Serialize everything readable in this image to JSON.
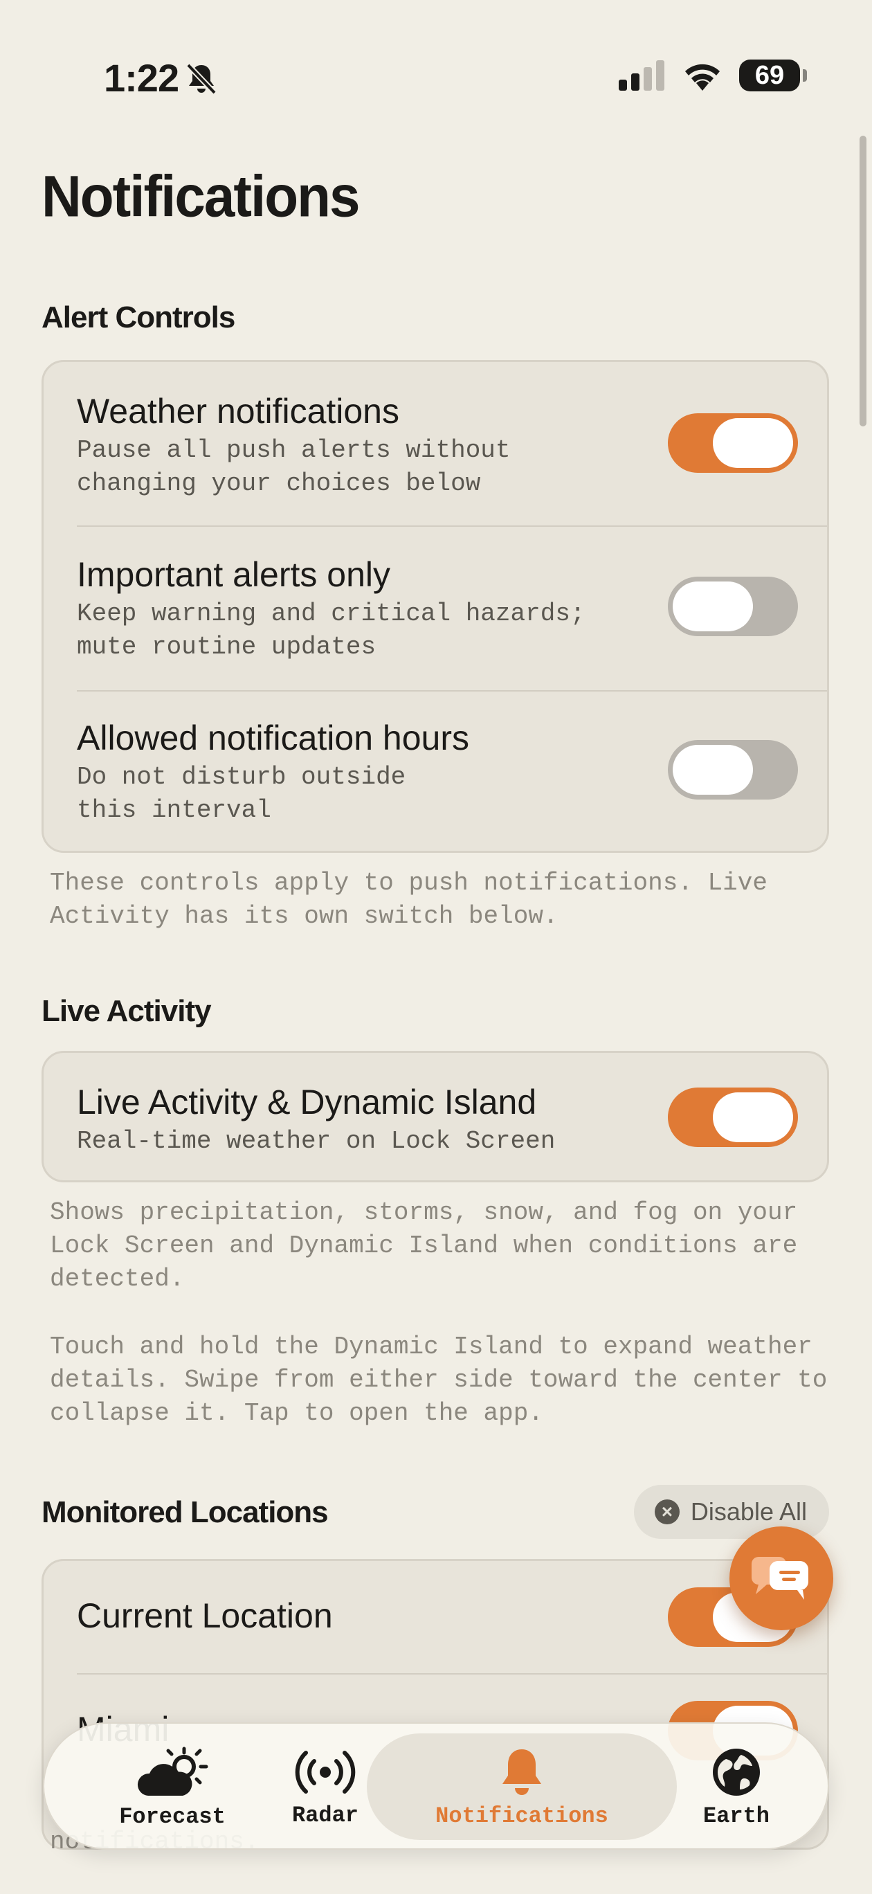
{
  "status": {
    "time": "1:22",
    "battery": "69"
  },
  "title": "Notifications",
  "sections": {
    "alert_controls": {
      "title": "Alert Controls",
      "rows": [
        {
          "title": "Weather notifications",
          "subtitle": "Pause all push alerts without\nchanging your choices below",
          "on": true
        },
        {
          "title": "Important alerts only",
          "subtitle": "Keep warning and critical hazards;\nmute routine updates",
          "on": false
        },
        {
          "title": "Allowed notification hours",
          "subtitle": "Do not disturb outside\nthis interval",
          "on": false
        }
      ],
      "footnote": "These controls apply to push notifications. Live Activity has its own switch below."
    },
    "live_activity": {
      "title": "Live Activity",
      "row": {
        "title": "Live Activity & Dynamic Island",
        "subtitle": "Real-time weather on Lock Screen",
        "on": true
      },
      "footnote1": "Shows precipitation, storms, snow, and fog on your Lock Screen and Dynamic Island when conditions are detected.",
      "footnote2": "Touch and hold the Dynamic Island to expand weather details. Swipe from either side toward the center to collapse it. Tap to open the app."
    },
    "monitored": {
      "title": "Monitored Locations",
      "disable_all": "Disable All",
      "rows": [
        {
          "title": "Current Location",
          "on": true
        },
        {
          "title": "Miami",
          "on": true
        }
      ],
      "bottom_note": "notifications."
    }
  },
  "tabs": [
    {
      "label": "Forecast",
      "icon": "cloud-sun-icon"
    },
    {
      "label": "Radar",
      "icon": "radar-icon"
    },
    {
      "label": "Notifications",
      "icon": "bell-icon",
      "active": true
    },
    {
      "label": "Earth",
      "icon": "globe-icon"
    }
  ],
  "colors": {
    "accent": "#e07a35",
    "background": "#f1eee5",
    "card": "#e8e4da"
  }
}
